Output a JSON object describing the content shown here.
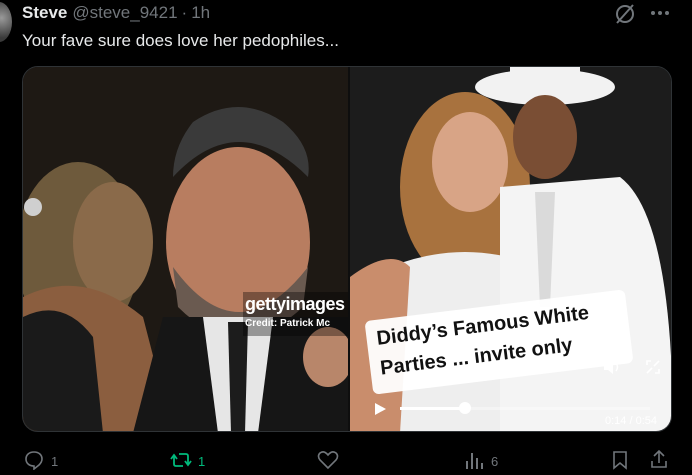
{
  "post": {
    "author_name": "Steve",
    "author_handle": "@steve_9421",
    "separator": "·",
    "time": "1h",
    "text": "Your fave sure does love her pedophiles..."
  },
  "media": {
    "left_photo": {
      "watermark_brand": "gettyimages",
      "watermark_credit": "Credit: Patrick Mc"
    },
    "right_video": {
      "caption_line1": "Diddy’s Famous White",
      "caption_line2": "Parties ... invite only",
      "time_display": "0:14 / 0:54",
      "progress_fraction": 0.26
    }
  },
  "actions": {
    "reply_count": "1",
    "repost_count": "1",
    "views_count": "6"
  },
  "colors": {
    "accent_repost": "#00ba7c",
    "muted": "#71767b",
    "text": "#e7e9ea"
  },
  "icons": {
    "reply": "reply-icon",
    "repost": "repost-icon",
    "like": "heart-icon",
    "views": "views-icon",
    "bookmark": "bookmark-icon",
    "share": "share-icon",
    "grok": "grok-icon",
    "more": "more-icon",
    "play": "play-icon",
    "volume": "volume-icon",
    "fullscreen": "fullscreen-icon"
  }
}
